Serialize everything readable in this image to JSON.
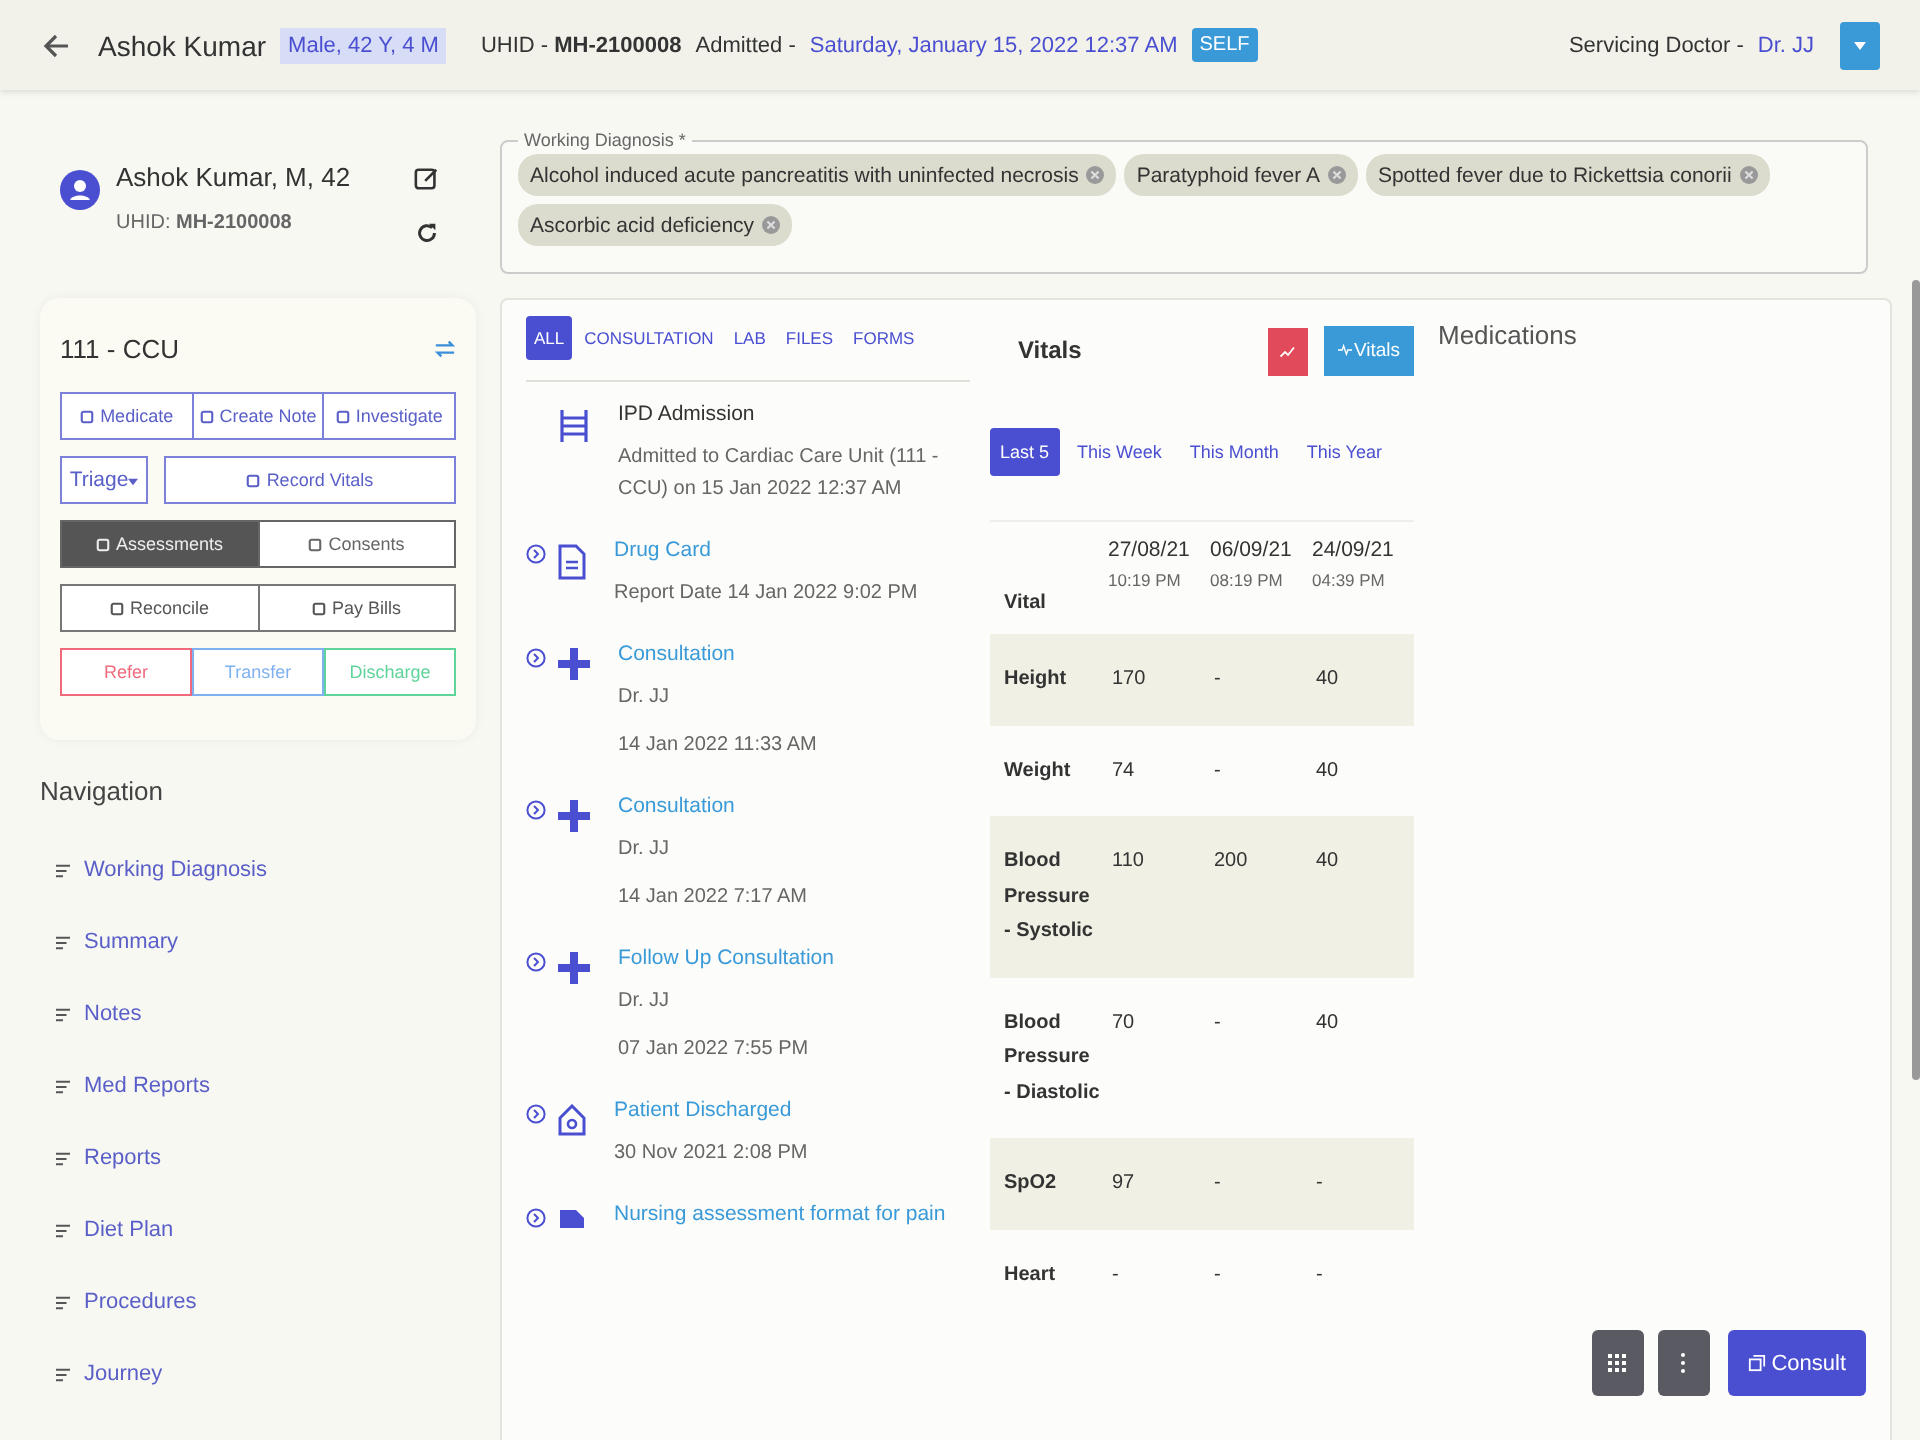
{
  "header": {
    "name": "Ashok Kumar",
    "demographics": "Male, 42 Y, 4 M",
    "uhid": "UHID - **MH-2100008**",
    "admitted_label": "Admitted -",
    "admitted_date": "Saturday, January 15, 2022 12:37 AM",
    "badge": "SELF",
    "doctor_label": "Servicing Doctor -",
    "doctor": "Dr. JJ"
  },
  "patient_card": {
    "name": "Ashok Kumar, M, 42",
    "uhid": "UHID: **MH-2100008**"
  },
  "diagnosis": {
    "label": "Working Diagnosis *",
    "chips": [
      "Alcohol induced acute pancreatitis with uninfected necrosis",
      "Paratyphoid fever A",
      "Spotted fever due to Rickettsia conorii",
      "Ascorbic acid deficiency"
    ]
  },
  "ward": {
    "title": "111 - CCU",
    "rows": [
      [
        {
          "label": "Medicate",
          "kind": "outline"
        },
        {
          "label": "Create Note",
          "kind": "outline"
        },
        {
          "label": "Investigate",
          "kind": "outline"
        }
      ],
      [
        {
          "label": "Triage",
          "kind": "dropdown"
        },
        {
          "label": "Record Vitals",
          "kind": "outline"
        }
      ],
      [
        {
          "label": "Assessments",
          "kind": "toggle",
          "selected": true
        },
        {
          "label": "Consents",
          "kind": "toggle",
          "selected": false
        }
      ],
      [
        {
          "label": "Reconcile",
          "kind": "plain"
        },
        {
          "label": "Pay Bills",
          "kind": "plain"
        }
      ],
      [
        {
          "label": "Refer",
          "kind": "colored",
          "color": "#f06a7c"
        },
        {
          "label": "Transfer",
          "kind": "colored",
          "color": "#7fb0f0"
        },
        {
          "label": "Discharge",
          "kind": "colored",
          "color": "#5ed39a"
        }
      ]
    ]
  },
  "navigation": {
    "title": "Navigation",
    "items": [
      "Working Diagnosis",
      "Summary",
      "Notes",
      "Med Reports",
      "Reports",
      "Diet Plan",
      "Procedures",
      "Journey"
    ]
  },
  "timeline": {
    "tabs": [
      {
        "label": "ALL",
        "selected": true
      },
      {
        "label": "CONSULTATION",
        "selected": false
      },
      {
        "label": "LAB",
        "selected": false
      },
      {
        "label": "FILES",
        "selected": false
      },
      {
        "label": "FORMS",
        "selected": false
      }
    ],
    "events": [
      {
        "kind": "admission",
        "title": "IPD Admission",
        "lines": [
          "Admitted to Cardiac Care Unit (111 - CCU) on 15 Jan 2022 12:37 AM"
        ]
      },
      {
        "kind": "document",
        "title": "Drug Card",
        "lines": [
          "Report Date 14 Jan 2022 9:02 PM"
        ]
      },
      {
        "kind": "consult",
        "title": "Consultation",
        "lines": [
          "Dr. JJ",
          "14 Jan 2022 11:33 AM"
        ]
      },
      {
        "kind": "consult",
        "title": "Consultation",
        "lines": [
          "Dr. JJ",
          "14 Jan 2022 7:17 AM"
        ]
      },
      {
        "kind": "consult",
        "title": "Follow Up Consultation",
        "lines": [
          "Dr. JJ",
          "07 Jan 2022 7:55 PM"
        ]
      },
      {
        "kind": "discharge",
        "title": "Patient Discharged",
        "lines": [
          "30 Nov 2021 2:08 PM"
        ]
      },
      {
        "kind": "nursing",
        "title": "Nursing assessment format for pain"
      }
    ]
  },
  "vitals": {
    "title": "Vitals",
    "add_button": "Vitals",
    "periods": [
      {
        "label": "Last 5",
        "selected": true
      },
      {
        "label": "This Week",
        "selected": false
      },
      {
        "label": "This Month",
        "selected": false
      },
      {
        "label": "This Year",
        "selected": false
      }
    ],
    "corner": "Vital",
    "columns": [
      {
        "date": "27/08/21",
        "time": "10:19 PM"
      },
      {
        "date": "06/09/21",
        "time": "08:19 PM"
      },
      {
        "date": "24/09/21",
        "time": "04:39 PM"
      }
    ],
    "rows": [
      {
        "label": "Height",
        "values": [
          "170",
          "-",
          "40"
        ]
      },
      {
        "label": "Weight",
        "values": [
          "74",
          "-",
          "40"
        ]
      },
      {
        "label": "Blood Pressure - Systolic",
        "values": [
          "110",
          "200",
          "40"
        ]
      },
      {
        "label": "Blood Pressure - Diastolic",
        "values": [
          "70",
          "-",
          "40"
        ]
      },
      {
        "label": "SpO2",
        "values": [
          "97",
          "-",
          "-"
        ]
      },
      {
        "label": "Heart",
        "values": [
          "-",
          "-",
          "-"
        ]
      }
    ]
  },
  "medications": {
    "title": "Medications"
  },
  "actions": {
    "consult": "Consult"
  }
}
